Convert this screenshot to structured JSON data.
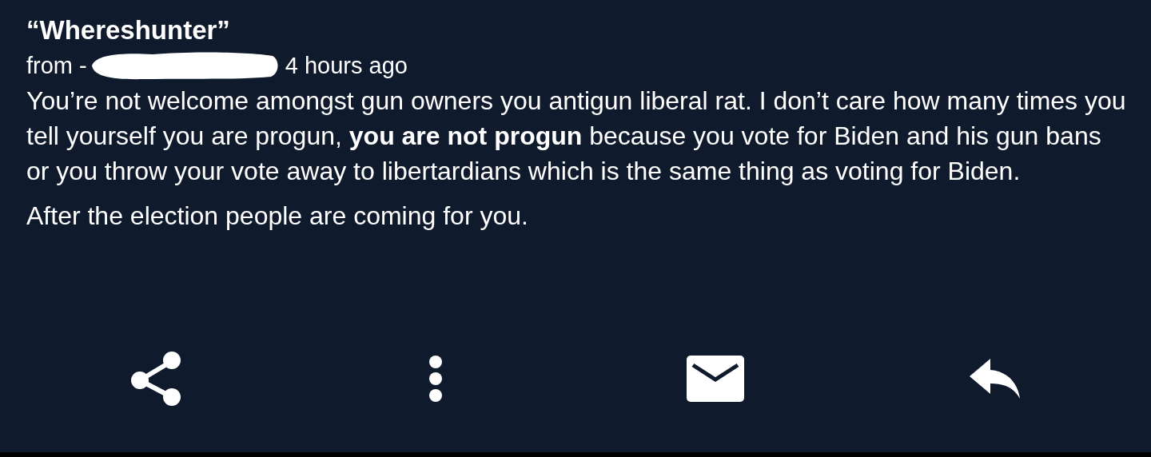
{
  "message": {
    "title": "“Whereshunter”",
    "from_label": "from -",
    "time": "4 hours ago",
    "paragraphs": [
      "You’re not welcome amongst gun owners you antigun liberal rat. I don’t care how many times you tell yourself you are progun, **you are not progun** because you vote for Biden and his gun bans or you throw your vote away to libertardians which is the same thing as voting for Biden.",
      "After the election people are coming for you."
    ]
  },
  "actions": [
    {
      "kind": "share"
    },
    {
      "kind": "more"
    },
    {
      "kind": "mail"
    },
    {
      "kind": "reply"
    }
  ]
}
